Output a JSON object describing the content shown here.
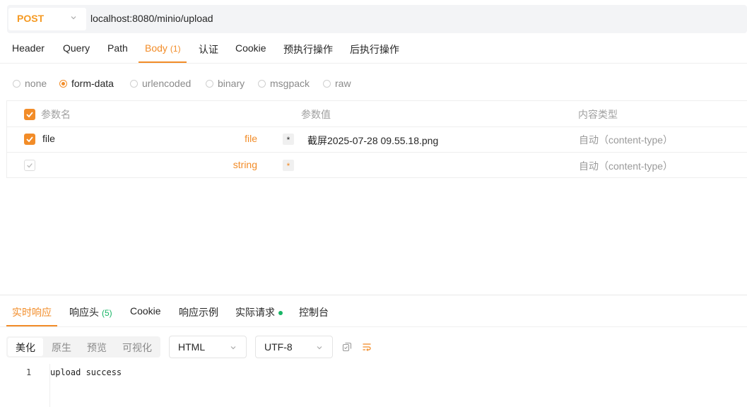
{
  "request": {
    "method": "POST",
    "url": "localhost:8080/minio/upload",
    "tabs": [
      {
        "label": "Header",
        "count": ""
      },
      {
        "label": "Query",
        "count": ""
      },
      {
        "label": "Path",
        "count": ""
      },
      {
        "label": "Body",
        "count": "(1)"
      },
      {
        "label": "认证",
        "count": ""
      },
      {
        "label": "Cookie",
        "count": ""
      },
      {
        "label": "预执行操作",
        "count": ""
      },
      {
        "label": "后执行操作",
        "count": ""
      }
    ],
    "body_types": [
      "none",
      "form-data",
      "urlencoded",
      "binary",
      "msgpack",
      "raw"
    ],
    "selected_body_type": "form-data",
    "param_headers": {
      "name": "参数名",
      "value": "参数值",
      "content_type": "内容类型"
    },
    "params": [
      {
        "name": "file",
        "type": "file",
        "value": "截屏2025-07-28 09.55.18.png",
        "content_type": "自动（content-type）",
        "enabled": true
      },
      {
        "name": "",
        "type": "string",
        "value": "",
        "content_type": "自动（content-type）",
        "enabled": false
      }
    ]
  },
  "response": {
    "tabs": [
      {
        "label": "实时响应",
        "count": ""
      },
      {
        "label": "响应头",
        "count": "(5)"
      },
      {
        "label": "Cookie",
        "count": ""
      },
      {
        "label": "响应示例",
        "count": ""
      },
      {
        "label": "实际请求",
        "count": ""
      },
      {
        "label": "控制台",
        "count": ""
      }
    ],
    "view_modes": [
      "美化",
      "原生",
      "预览",
      "可视化"
    ],
    "format": "HTML",
    "encoding": "UTF-8",
    "line_number": "1",
    "body": "upload success"
  },
  "colors": {
    "accent": "#f28c28",
    "method": "#f59a23",
    "success": "#18b566"
  }
}
